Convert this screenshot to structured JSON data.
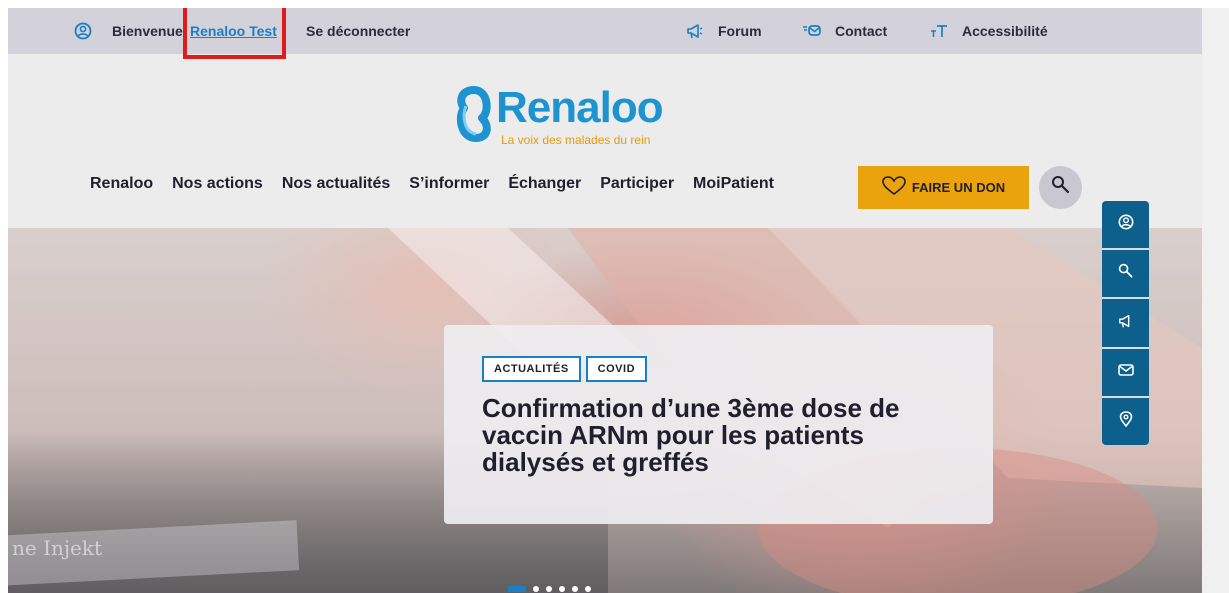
{
  "topbar": {
    "welcome": "Bienvenue",
    "user_link": "Renaloo Test",
    "logout": "Se déconnecter",
    "forum": "Forum",
    "contact": "Contact",
    "accessibility": "Accessibilité",
    "icons": [
      "user-circle-icon",
      "megaphone-icon",
      "mail-icon",
      "text-size-icon"
    ]
  },
  "logo": {
    "name": "Renaloo",
    "tagline": "La voix des malades du rein",
    "colors": {
      "blue": "#1d93d0",
      "orange": "#e59b0d"
    }
  },
  "nav": {
    "items": [
      "Renaloo",
      "Nos actions",
      "Nos actualités",
      "S’informer",
      "Échanger",
      "Participer",
      "MoiPatient"
    ]
  },
  "don_button": {
    "label": "FAIRE UN DON",
    "color": "#eaa30d"
  },
  "hero": {
    "tags": [
      "ACTUALITÉS",
      "COVID"
    ],
    "title": "Confirmation d’une 3ème dose de vaccin ARNm pour les patients dialysés et greffés",
    "image_text": "ne Injekt",
    "slides_total": 6,
    "active_slide": 1
  },
  "side_tools": [
    "user-circle-icon",
    "search-icon",
    "megaphone-icon",
    "mail-icon",
    "location-pin-icon"
  ],
  "accent": "#1a7fc4"
}
